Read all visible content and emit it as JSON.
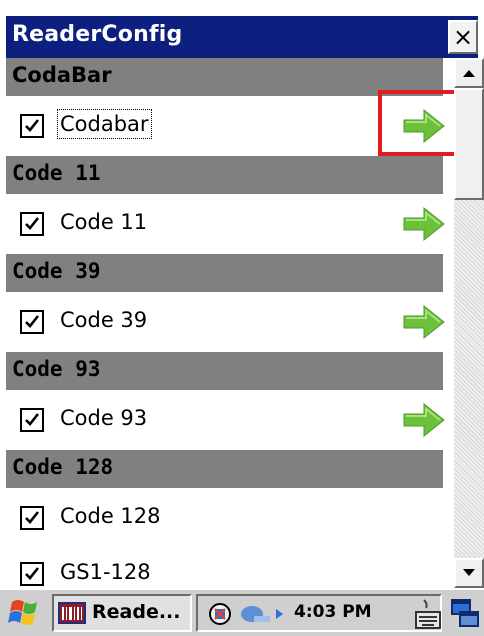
{
  "window": {
    "title": "ReaderConfig",
    "close_label": "×"
  },
  "sections": [
    {
      "label": "CodaBar",
      "items": [
        {
          "label": "Codabar",
          "checked": true,
          "has_arrow": true,
          "focused": true
        }
      ]
    },
    {
      "label": "Code 11",
      "items": [
        {
          "label": "Code 11",
          "checked": true,
          "has_arrow": true
        }
      ]
    },
    {
      "label": "Code 39",
      "items": [
        {
          "label": "Code 39",
          "checked": true,
          "has_arrow": true
        }
      ]
    },
    {
      "label": "Code 93",
      "items": [
        {
          "label": "Code 93",
          "checked": true,
          "has_arrow": true
        }
      ]
    },
    {
      "label": "Code 128",
      "items": [
        {
          "label": "Code 128",
          "checked": true,
          "has_arrow": false
        },
        {
          "label": "GS1-128",
          "checked": true,
          "has_arrow": false
        }
      ]
    }
  ],
  "taskbar": {
    "task_label": "Reade...",
    "clock": "4:03 PM"
  },
  "colors": {
    "titlebar": "#0d1f7f",
    "section": "#808080",
    "arrow": "#6cc13a",
    "highlight": "#e01c1c"
  },
  "icons": [
    "start-flag-icon",
    "task-app-icon",
    "network-icon",
    "connection-icon",
    "keyboard-icon",
    "desktop-switch-icon",
    "green-arrow-icon",
    "scroll-up-icon",
    "scroll-down-icon"
  ]
}
